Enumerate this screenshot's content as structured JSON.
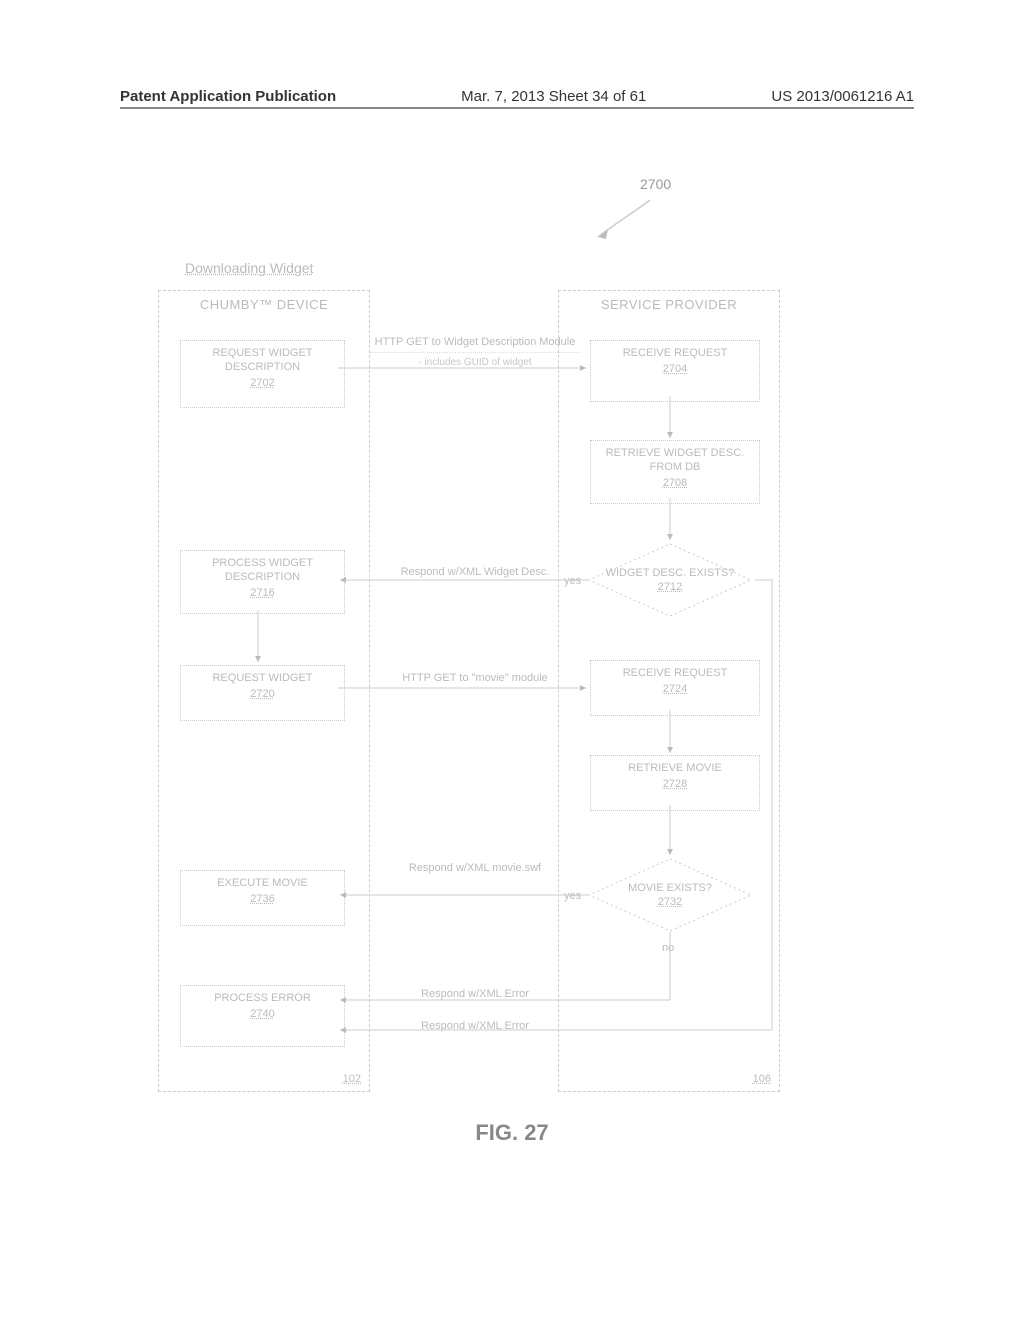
{
  "header": {
    "left": "Patent Application Publication",
    "center": "Mar. 7, 2013  Sheet 34 of 61",
    "right": "US 2013/0061216 A1"
  },
  "figure_ref": "2700",
  "section_title": "Downloading Widget",
  "lanes": {
    "left_title": "CHUMBY™ DEVICE",
    "right_title": "SERVICE PROVIDER",
    "left_ref": "102",
    "right_ref": "106"
  },
  "boxes": {
    "b2702": {
      "text": "REQUEST WIDGET DESCRIPTION",
      "ref": "2702"
    },
    "b2704": {
      "text": "RECEIVE REQUEST",
      "ref": "2704"
    },
    "b2708": {
      "text": "RETRIEVE WIDGET DESC. FROM DB",
      "ref": "2708"
    },
    "b2716": {
      "text": "PROCESS WIDGET DESCRIPTION",
      "ref": "2716"
    },
    "b2720": {
      "text": "REQUEST WIDGET",
      "ref": "2720"
    },
    "b2724": {
      "text": "RECEIVE REQUEST",
      "ref": "2724"
    },
    "b2728": {
      "text": "RETRIEVE MOVIE",
      "ref": "2728"
    },
    "b2736": {
      "text": "EXECUTE MOVIE",
      "ref": "2736"
    },
    "b2740": {
      "text": "PROCESS ERROR",
      "ref": "2740"
    }
  },
  "diamonds": {
    "d2712": {
      "text": "WIDGET DESC. EXISTS?",
      "ref": "2712"
    },
    "d2732": {
      "text": "MOVIE EXISTS?",
      "ref": "2732"
    }
  },
  "messages": {
    "m1a": "HTTP GET to Widget Description Module",
    "m1b": "- includes GUID of widget",
    "m2": "Respond w/XML Widget Desc.",
    "m3": "HTTP GET to \"movie\" module",
    "m4": "Respond w/XML movie.swf",
    "m5": "Respond w/XML Error",
    "m6": "Respond w/XML Error"
  },
  "labels": {
    "yes1": "yes",
    "yes2": "yes",
    "no": "no"
  },
  "caption": "FIG. 27"
}
